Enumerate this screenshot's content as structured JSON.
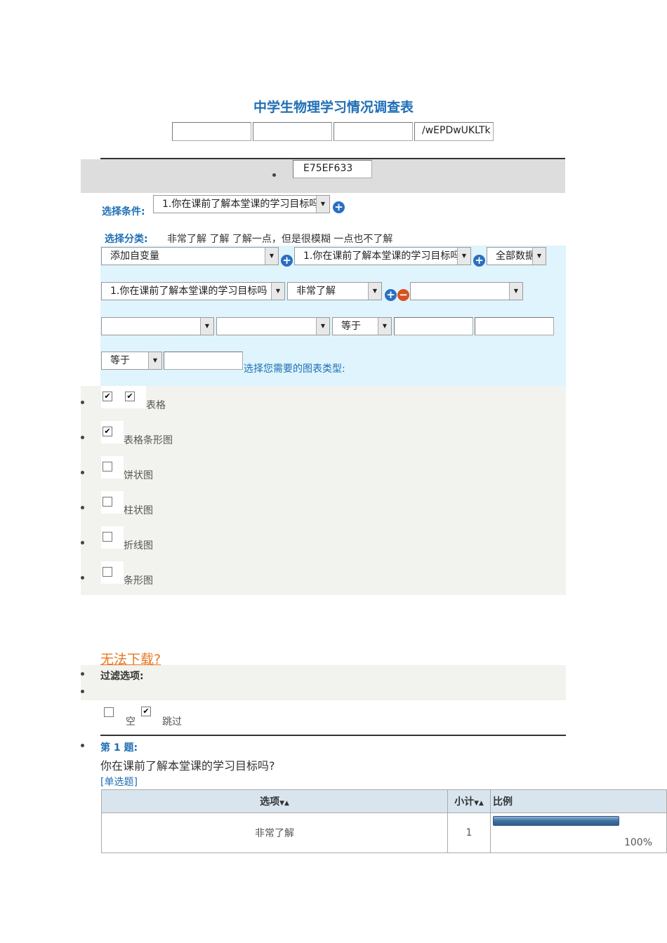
{
  "title": "中学生物理学习情况调查表",
  "top_fields": [
    "",
    "",
    "",
    "/wEPDwUKLTk"
  ],
  "hidden_field": "E75EF633",
  "condition": {
    "label": "选择条件:",
    "select": "1.你在课前了解本堂课的学习目标吗"
  },
  "category": {
    "label": "选择分类:",
    "values": "非常了解 了解 了解一点，但是很模糊 一点也不了解"
  },
  "row1": {
    "var_select": "添加自变量",
    "question_select": "1.你在课前了解本堂课的学习目标吗",
    "data_select": "全部数据"
  },
  "row2": {
    "question_select": "1.你在课前了解本堂课的学习目标吗",
    "option_select": "非常了解",
    "extra_select": ""
  },
  "row3": {
    "op_select": "等于"
  },
  "row4": {
    "op_select": "等于",
    "chart_type_label": "选择您需要的图表类型:"
  },
  "chart_types": [
    {
      "label": "表格",
      "checked": true
    },
    {
      "label": "表格条形图",
      "checked": true
    },
    {
      "label": "饼状图",
      "checked": false
    },
    {
      "label": "柱状图",
      "checked": false
    },
    {
      "label": "折线图",
      "checked": false
    },
    {
      "label": "条形图",
      "checked": false
    }
  ],
  "download_link": "无法下载?",
  "filter": {
    "label": "过滤选项:",
    "empty_label": "空",
    "empty_checked": false,
    "skip_label": "跳过",
    "skip_checked": true
  },
  "question": {
    "number": "第 1 题:",
    "text": "你在课前了解本堂课的学习目标吗?",
    "type": "[单选题]",
    "headers": [
      "选项",
      "小计",
      "比例"
    ],
    "rows": [
      {
        "option": "非常了解",
        "count": "1",
        "percent": "100%",
        "fraction": 1.0
      }
    ]
  },
  "colors": {
    "accent": "#1f6fb5",
    "link": "#e87722",
    "panel_blue": "#dff4fd",
    "panel_gray": "#f2f2ee"
  }
}
